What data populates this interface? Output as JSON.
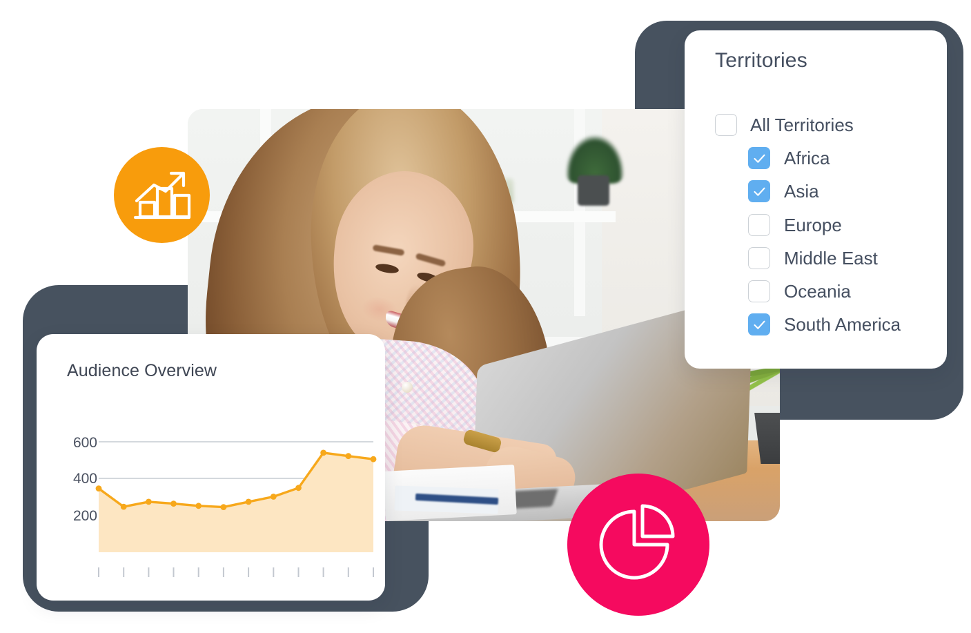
{
  "page": {
    "title": "Analytics dashboard illustration",
    "background_color": "#ffffff"
  },
  "colors": {
    "bezel": "#47525f",
    "accent_orange": "#f89c0c",
    "accent_pink": "#f50a5f",
    "checkbox_blue": "#60aef0",
    "text_dark": "#454f60",
    "chart_line": "#f7a81b",
    "chart_area": "#fde6c2"
  },
  "territories_panel": {
    "title": "Territories",
    "items": [
      {
        "label": "All Territories",
        "checked": false,
        "indent": 0
      },
      {
        "label": "Africa",
        "checked": true,
        "indent": 1
      },
      {
        "label": "Asia",
        "checked": true,
        "indent": 1
      },
      {
        "label": "Europe",
        "checked": false,
        "indent": 1
      },
      {
        "label": "Middle East",
        "checked": false,
        "indent": 1
      },
      {
        "label": "Oceania",
        "checked": false,
        "indent": 1
      },
      {
        "label": "South America",
        "checked": true,
        "indent": 1
      }
    ]
  },
  "audience_panel": {
    "title": "Audience Overview"
  },
  "icons": {
    "growth": "bar-chart-trending-up-icon",
    "pie": "pie-chart-icon"
  },
  "photo": {
    "alt": "Smiling woman with long blonde hair working on a laptop at a bright desk"
  },
  "chart_data": {
    "type": "area",
    "title": "Audience Overview",
    "xlabel": "",
    "ylabel": "",
    "ylim": [
      0,
      680
    ],
    "yticks": [
      200,
      400,
      600
    ],
    "ytick_labels": [
      "200",
      "400",
      "600"
    ],
    "grid": true,
    "legend": "none",
    "x": [
      1,
      2,
      3,
      4,
      5,
      6,
      7,
      8,
      9,
      10,
      11,
      12
    ],
    "xtick_count": 12,
    "xtick_labels": [
      "",
      "",
      "",
      "",
      "",
      "",
      "",
      "",
      "",
      "",
      "",
      ""
    ],
    "series": [
      {
        "name": "Audience",
        "values": [
          345,
          245,
          272,
          262,
          250,
          243,
          272,
          300,
          348,
          540,
          522,
          505
        ],
        "line_color": "#f7a81b",
        "fill_color": "#fde6c2",
        "marker": "circle"
      }
    ]
  }
}
